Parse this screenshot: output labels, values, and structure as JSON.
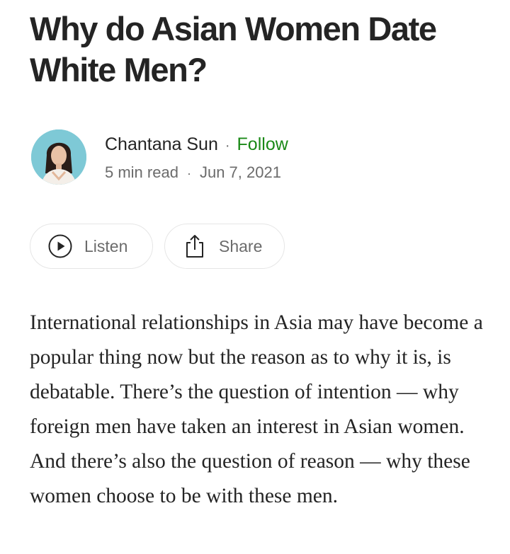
{
  "article": {
    "title": "Why do Asian Women Date White Men?",
    "body": "International relationships in Asia may have become a popular thing now but the reason as to why it is, is debatable. There’s the question of intention — why foreign men have taken an interest in Asian women. And there’s also the question of reason — why these women choose to be with these men."
  },
  "author": {
    "name": "Chantana Sun",
    "separator": "·",
    "follow_label": "Follow",
    "read_time": "5 min read",
    "date": "Jun 7, 2021"
  },
  "actions": {
    "listen_label": "Listen",
    "listen_icon": "play-circle-icon",
    "share_label": "Share",
    "share_icon": "share-icon"
  },
  "colors": {
    "text": "#242424",
    "muted": "#6b6b6b",
    "follow": "#1a8917",
    "border": "#e6e6e6"
  }
}
